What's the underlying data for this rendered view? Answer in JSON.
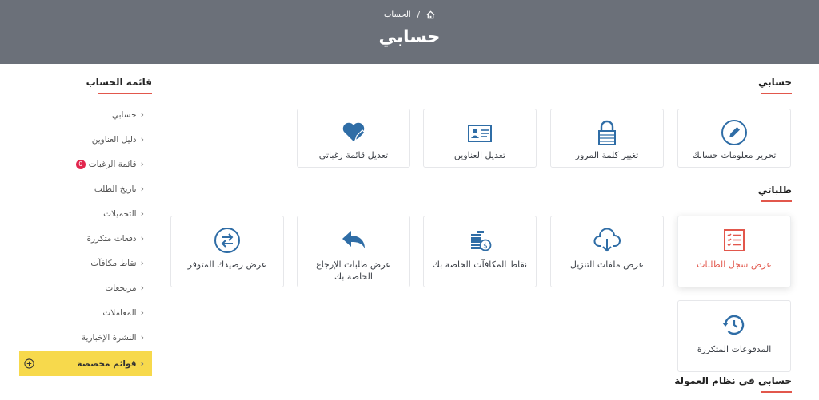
{
  "breadcrumb": {
    "current": "الحساب"
  },
  "page": {
    "title": "حسابي"
  },
  "sections": {
    "account": "حسابي",
    "orders": "طلباتي",
    "affiliate": "حسابي في نظام العمولة"
  },
  "account_tiles": [
    {
      "label": "تحرير معلومات حسابك",
      "icon": "pencil-icon"
    },
    {
      "label": "تغيير كلمة المرور",
      "icon": "lock-icon"
    },
    {
      "label": "تعديل العناوين",
      "icon": "address-card-icon"
    },
    {
      "label": "تعديل قائمة رغباتي",
      "icon": "heart-edit-icon"
    }
  ],
  "order_tiles": [
    {
      "label": "عرض سجل الطلبات",
      "icon": "checklist-icon"
    },
    {
      "label": "عرض ملفات التنزيل",
      "icon": "cloud-download-icon"
    },
    {
      "label": "نقاط المكافآت الخاصة بك",
      "icon": "coins-icon"
    },
    {
      "label": "عرض طلبات الإرجاع الخاصة بك",
      "icon": "reply-arrow-icon"
    },
    {
      "label": "عرض رصيدك المتوفر",
      "icon": "exchange-icon"
    },
    {
      "label": "المدفوعات المتكررة",
      "icon": "history-icon"
    }
  ],
  "sidebar": {
    "title": "قائمة الحساب",
    "items": [
      {
        "label": "حسابي"
      },
      {
        "label": "دليل العناوين"
      },
      {
        "label": "قائمة الرغبات",
        "badge": "0"
      },
      {
        "label": "تاريخ الطلب"
      },
      {
        "label": "التحميلات"
      },
      {
        "label": "دفعات متكررة"
      },
      {
        "label": "نقاط مكافآت"
      },
      {
        "label": "مرتجعات"
      },
      {
        "label": "المعاملات"
      },
      {
        "label": "النشرة الإخبارية"
      },
      {
        "label": "قوائم مخصصة"
      }
    ]
  },
  "colors": {
    "header": "#6b7079",
    "accent": "#e2574c",
    "icon": "#2f6da6",
    "highlight": "#f7d94c",
    "badge": "#e2264d"
  }
}
